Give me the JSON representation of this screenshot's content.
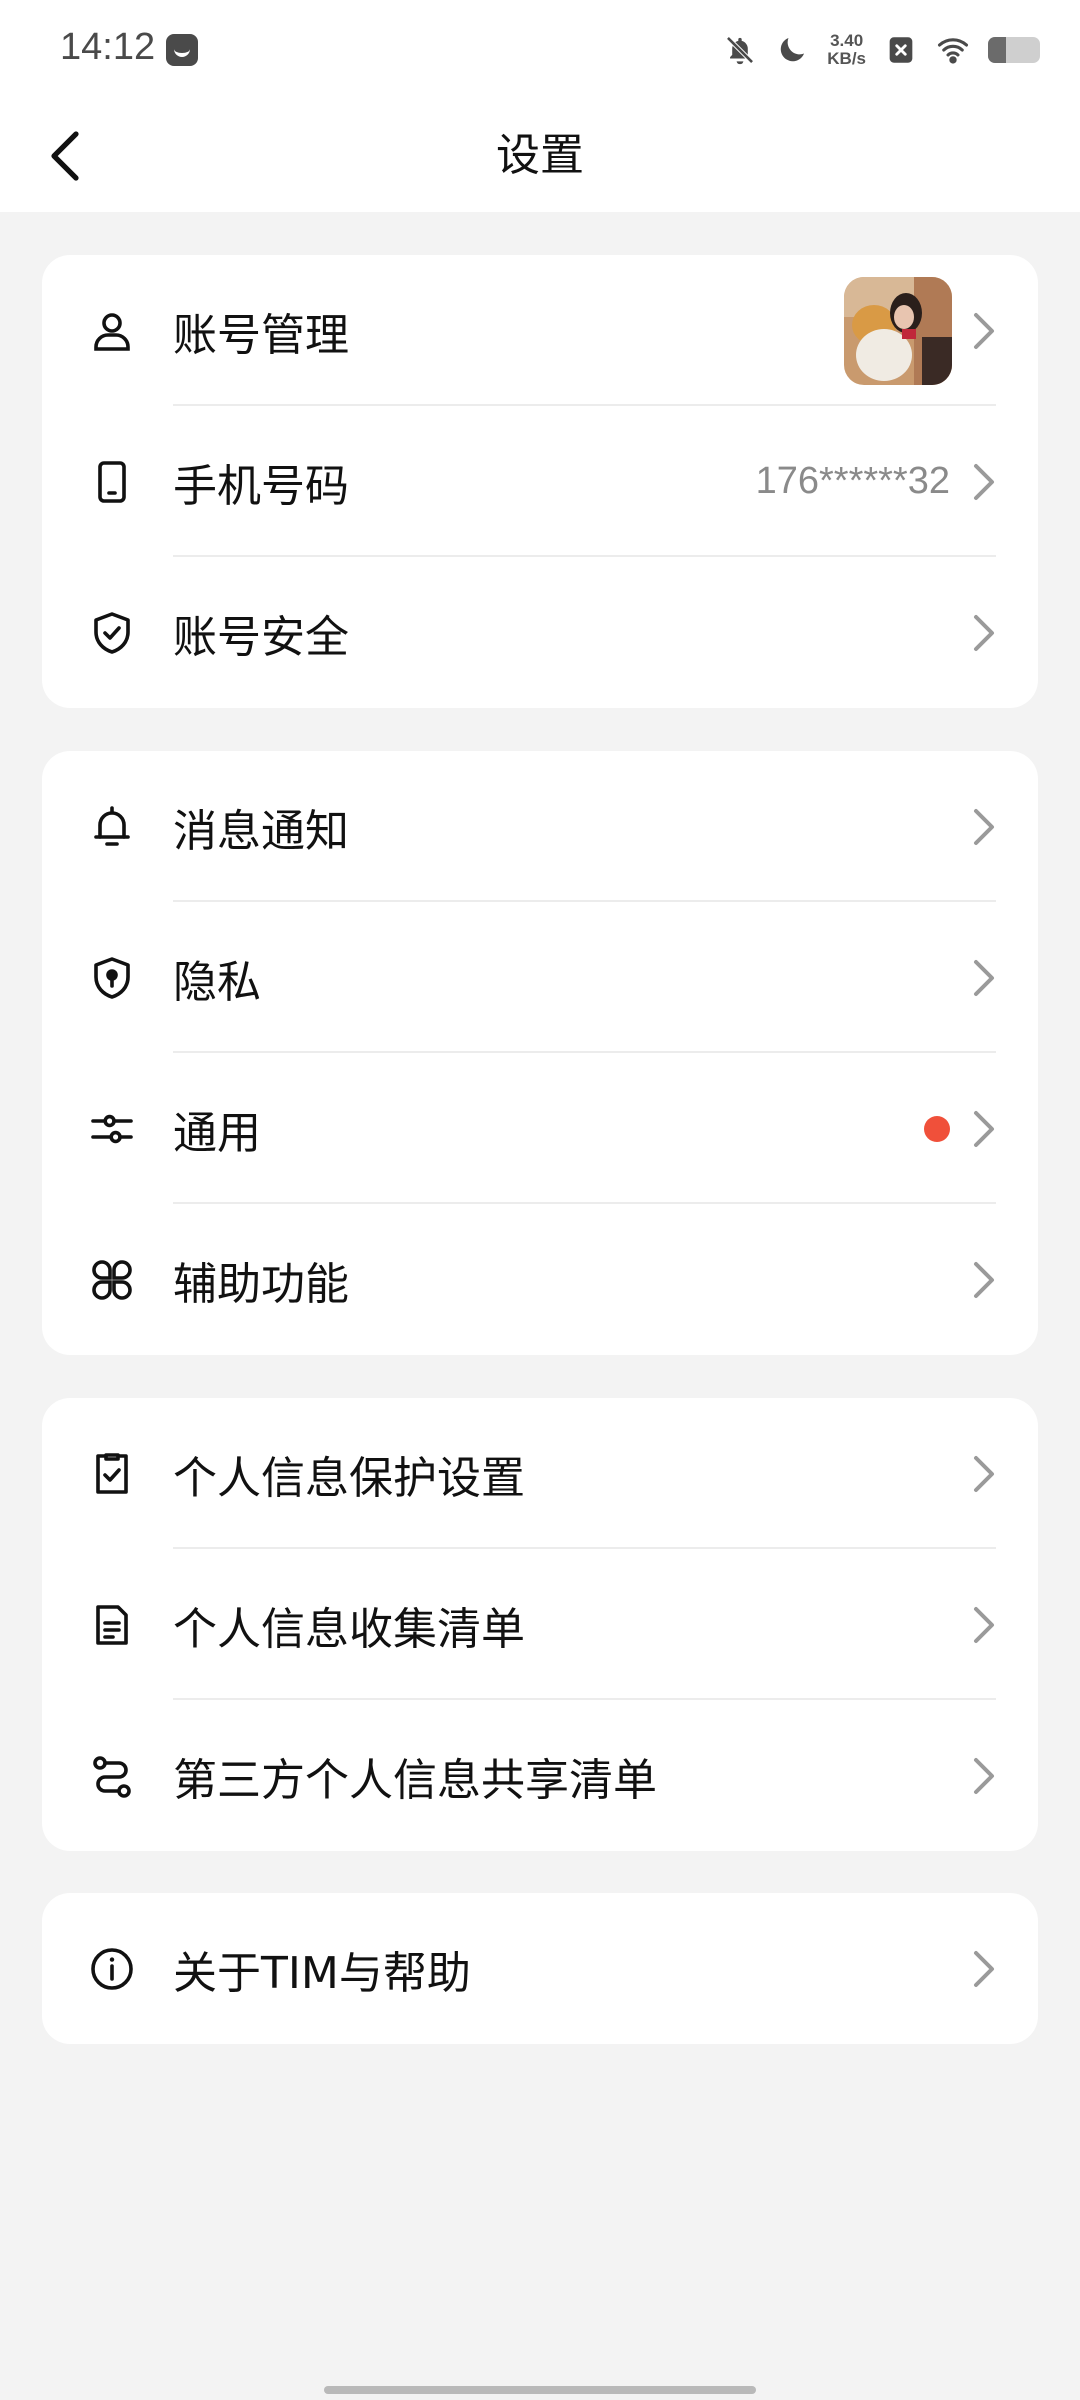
{
  "status_bar": {
    "time": "14:12",
    "app_icon": "notification-app-icon",
    "net_speed_value": "3.40",
    "net_speed_unit": "KB/s",
    "icons": [
      "bell-muted-icon",
      "moon-icon",
      "net-speed",
      "no-sim-icon",
      "wifi-icon",
      "battery-icon"
    ]
  },
  "header": {
    "back_icon": "chevron-left-icon",
    "title": "设置"
  },
  "groups": [
    {
      "items": [
        {
          "label": "账号管理",
          "icon": "person-icon",
          "trailing": "avatar"
        },
        {
          "label": "手机号码",
          "icon": "phone-icon",
          "value": "176******32"
        },
        {
          "label": "账号安全",
          "icon": "shield-check-icon"
        }
      ]
    },
    {
      "items": [
        {
          "label": "消息通知",
          "icon": "bell-icon"
        },
        {
          "label": "隐私",
          "icon": "shield-lock-icon"
        },
        {
          "label": "通用",
          "icon": "sliders-icon",
          "badge": "red-dot"
        },
        {
          "label": "辅助功能",
          "icon": "grid-shapes-icon"
        }
      ]
    },
    {
      "items": [
        {
          "label": "个人信息保护设置",
          "icon": "checkbox-doc-icon"
        },
        {
          "label": "个人信息收集清单",
          "icon": "document-list-icon"
        },
        {
          "label": "第三方个人信息共享清单",
          "icon": "share-flow-icon"
        }
      ]
    },
    {
      "items": [
        {
          "label": "关于TIM与帮助",
          "icon": "info-circle-icon"
        }
      ]
    }
  ],
  "colors": {
    "page_bg": "#f3f3f3",
    "card_bg": "#ffffff",
    "text_primary": "#111111",
    "text_secondary": "#8a8a8a",
    "chevron": "#9a9a9a",
    "badge_red": "#f0503a"
  }
}
